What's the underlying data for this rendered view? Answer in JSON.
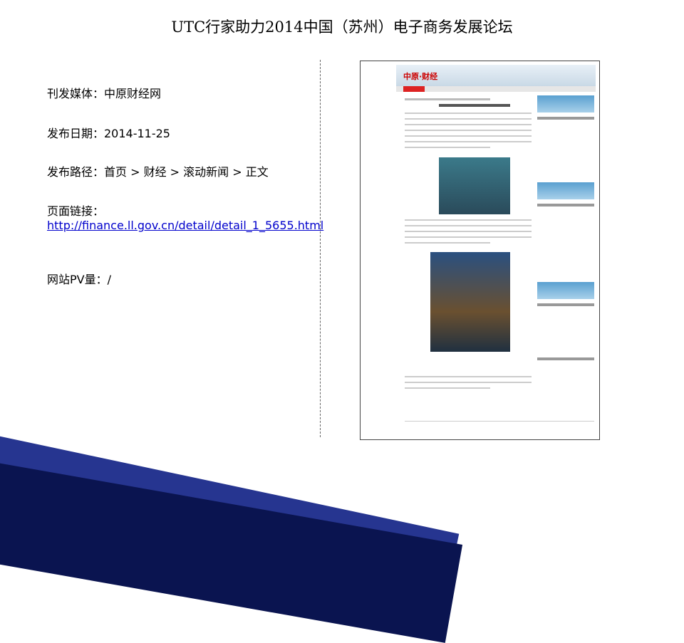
{
  "title": "UTC行家助力2014中国（苏州）电子商务发展论坛",
  "info": {
    "media": "刊发媒体：中原财经网",
    "date": "发布日期：2014-11-25",
    "path": "发布路径：首页 > 财经 > 滚动新闻 > 正文",
    "link_label": "页面链接：",
    "link_url": "http://finance.ll.gov.cn/detail/detail_1_5655.html",
    "pv": "网站PV量：/"
  },
  "screenshot": {
    "site_name": "中原·财经"
  },
  "colors": {
    "link": "#0000cc",
    "deco_dark": "#0a1450",
    "deco_mid": "#1a2a8a"
  }
}
